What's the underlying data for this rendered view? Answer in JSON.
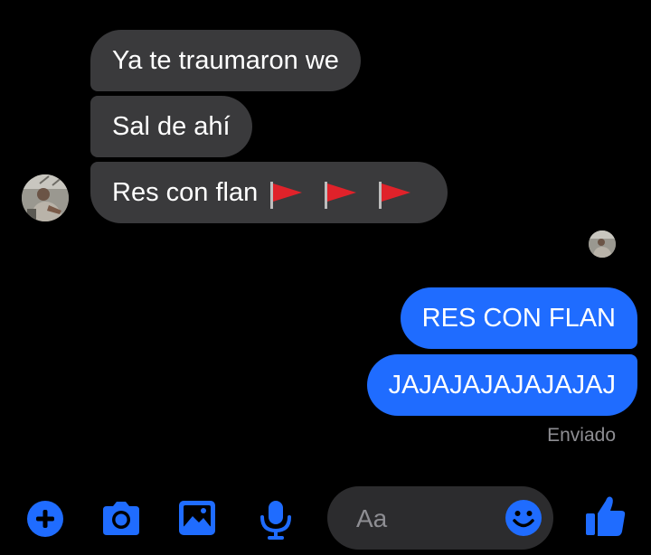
{
  "received": [
    {
      "text": "Ya te traumaron we"
    },
    {
      "text": "Sal de ahí"
    },
    {
      "text": "Res con flan",
      "emoji": [
        "red-flag",
        "red-flag",
        "red-flag"
      ]
    }
  ],
  "sent": [
    {
      "text": "RES CON FLAN"
    },
    {
      "text": "JAJAJAJAJAJAJAJ"
    }
  ],
  "status": "Enviado",
  "composer": {
    "placeholder": "Aa",
    "icons": [
      "plus-icon",
      "camera-icon",
      "image-icon",
      "microphone-icon",
      "emoji-icon",
      "thumbs-up-icon"
    ]
  },
  "colors": {
    "background": "#000000",
    "received_bubble": "#3a3a3c",
    "sent_bubble": "#1f6cff",
    "accent": "#1f6cff",
    "flag_red": "#e0222a"
  }
}
